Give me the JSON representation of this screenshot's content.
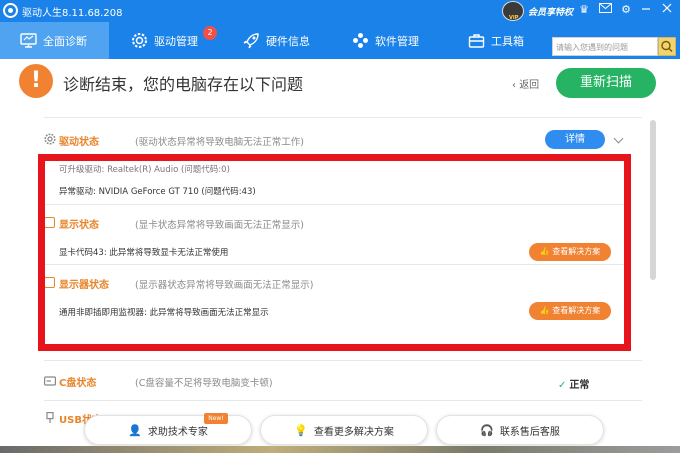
{
  "titlebar": {
    "app_title": "驱动人生8.11.68.208",
    "vip_label": "会员享特权",
    "vip_badge": "VIP"
  },
  "nav": {
    "tabs": [
      {
        "label": "全面诊断"
      },
      {
        "label": "驱动管理"
      },
      {
        "label": "硬件信息"
      },
      {
        "label": "软件管理"
      },
      {
        "label": "工具箱"
      }
    ],
    "driver_badge": "2",
    "search_placeholder": "请输入您遇到的问题"
  },
  "header": {
    "title": "诊断结束，您的电脑存在以下问题",
    "back": "返回",
    "rescan": "重新扫描"
  },
  "driver_section": {
    "title": "驱动状态",
    "desc": "(驱动状态异常将导致电脑无法正常工作)",
    "detail_btn": "详情",
    "partial_row": "可升级驱动: Realtek(R) Audio (问题代码:0)",
    "row": "异常驱动: NVIDIA GeForce GT 710 (问题代码:43)"
  },
  "display_section": {
    "title": "显示状态",
    "desc": "(显卡状态异常将导致画面无法正常显示)",
    "row": "显卡代码43: 此异常将导致显卡无法正常使用",
    "solve_btn": "查看解决方案"
  },
  "monitor_section": {
    "title": "显示器状态",
    "desc": "(显示器状态异常将导致画面无法正常显示)",
    "row": "通用非即插即用监视器: 此异常将导致画面无法正常显示",
    "solve_btn": "查看解决方案"
  },
  "c_section": {
    "title": "C盘状态",
    "desc": "(C盘容量不足将导致电脑变卡顿)",
    "status": "正常"
  },
  "usb_section": {
    "title": "USB状态"
  },
  "bottom_buttons": [
    {
      "label": "求助技术专家",
      "tag": "New!"
    },
    {
      "label": "查看更多解决方案"
    },
    {
      "label": "联系售后客服"
    }
  ],
  "colors": {
    "primary": "#1a82e8",
    "warning": "#f08231",
    "success": "#26b364",
    "alert": "#e8141c"
  }
}
